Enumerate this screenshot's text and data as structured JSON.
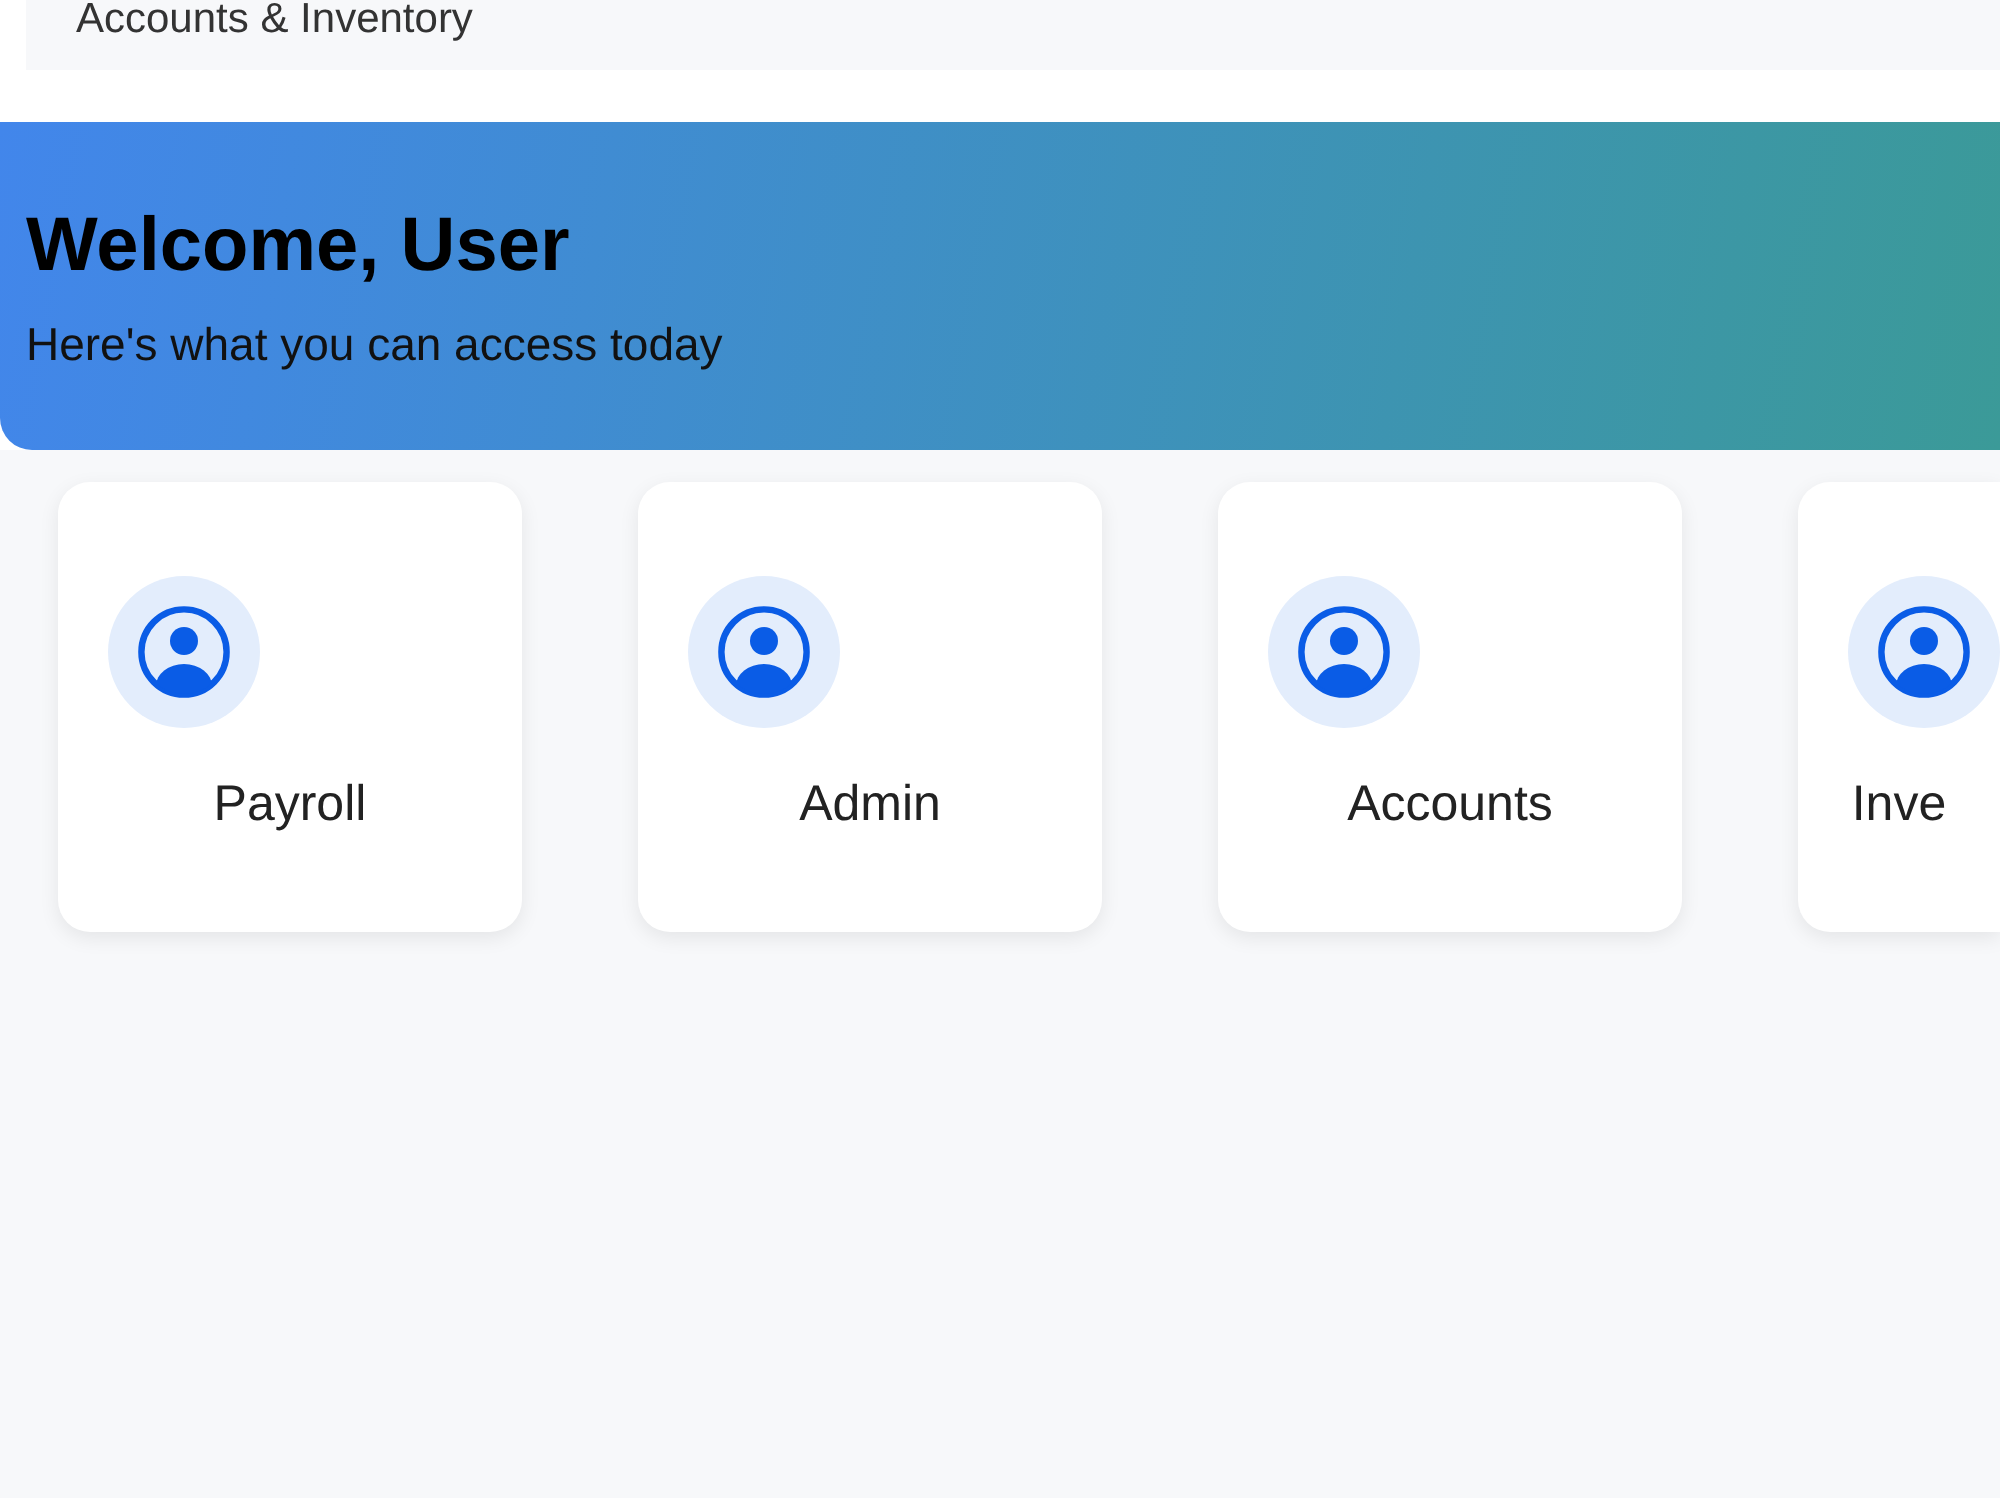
{
  "header": {
    "title": "Accounts & Inventory"
  },
  "banner": {
    "title": "Welcome, User",
    "subtitle": "Here's what you can access today"
  },
  "modules": [
    {
      "label": "Payroll"
    },
    {
      "label": "Admin"
    },
    {
      "label": "Accounts"
    },
    {
      "label": "Inve"
    }
  ]
}
